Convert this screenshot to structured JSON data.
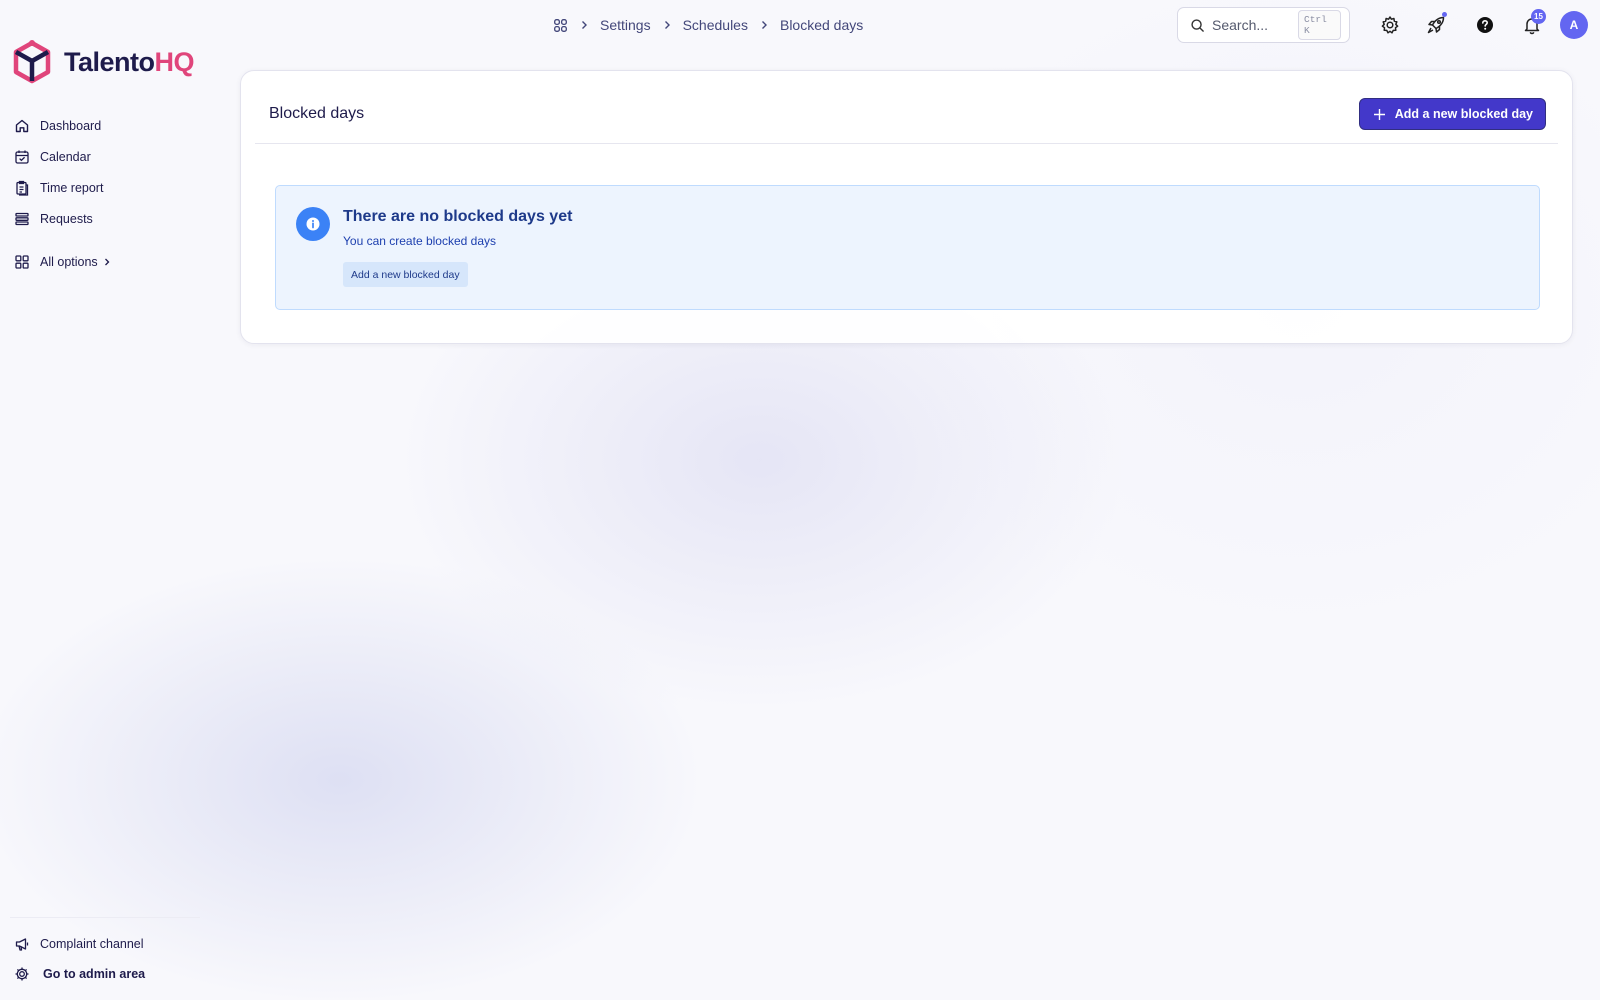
{
  "brand": {
    "name_part1": "Talento",
    "name_part2": "HQ",
    "logo_icon": "cube-logo-icon",
    "accent": "#e0457b",
    "dark": "#1e1b4b"
  },
  "sidebar": {
    "items": [
      {
        "label": "Dashboard",
        "icon": "home-icon"
      },
      {
        "label": "Calendar",
        "icon": "calendar-icon"
      },
      {
        "label": "Time report",
        "icon": "clipboard-icon"
      },
      {
        "label": "Requests",
        "icon": "list-icon"
      }
    ],
    "all_options": {
      "label": "All options",
      "icon": "grid-icon"
    },
    "bottom": [
      {
        "label": "Complaint channel",
        "icon": "megaphone-icon"
      },
      {
        "label": "Go to admin area",
        "icon": "gear-icon"
      }
    ]
  },
  "breadcrumb": {
    "home_icon": "apps-icon",
    "items": [
      "Settings",
      "Schedules",
      "Blocked days"
    ]
  },
  "topbar": {
    "search_placeholder": "Search...",
    "search_shortcut": "Ctrl K",
    "icons": [
      "gear-icon",
      "rocket-icon",
      "help-icon",
      "bell-icon"
    ],
    "notification_count": "15",
    "avatar_initial": "A"
  },
  "main": {
    "title": "Blocked days",
    "add_button_label": "Add a new blocked day",
    "empty_state": {
      "title": "There are no blocked days yet",
      "subtitle": "You can create blocked days",
      "button_label": "Add a new blocked day"
    }
  },
  "colors": {
    "primary": "#4338ca",
    "info_bg": "#edf4fe",
    "info_icon": "#3b82f6",
    "badge": "#6366f1"
  }
}
